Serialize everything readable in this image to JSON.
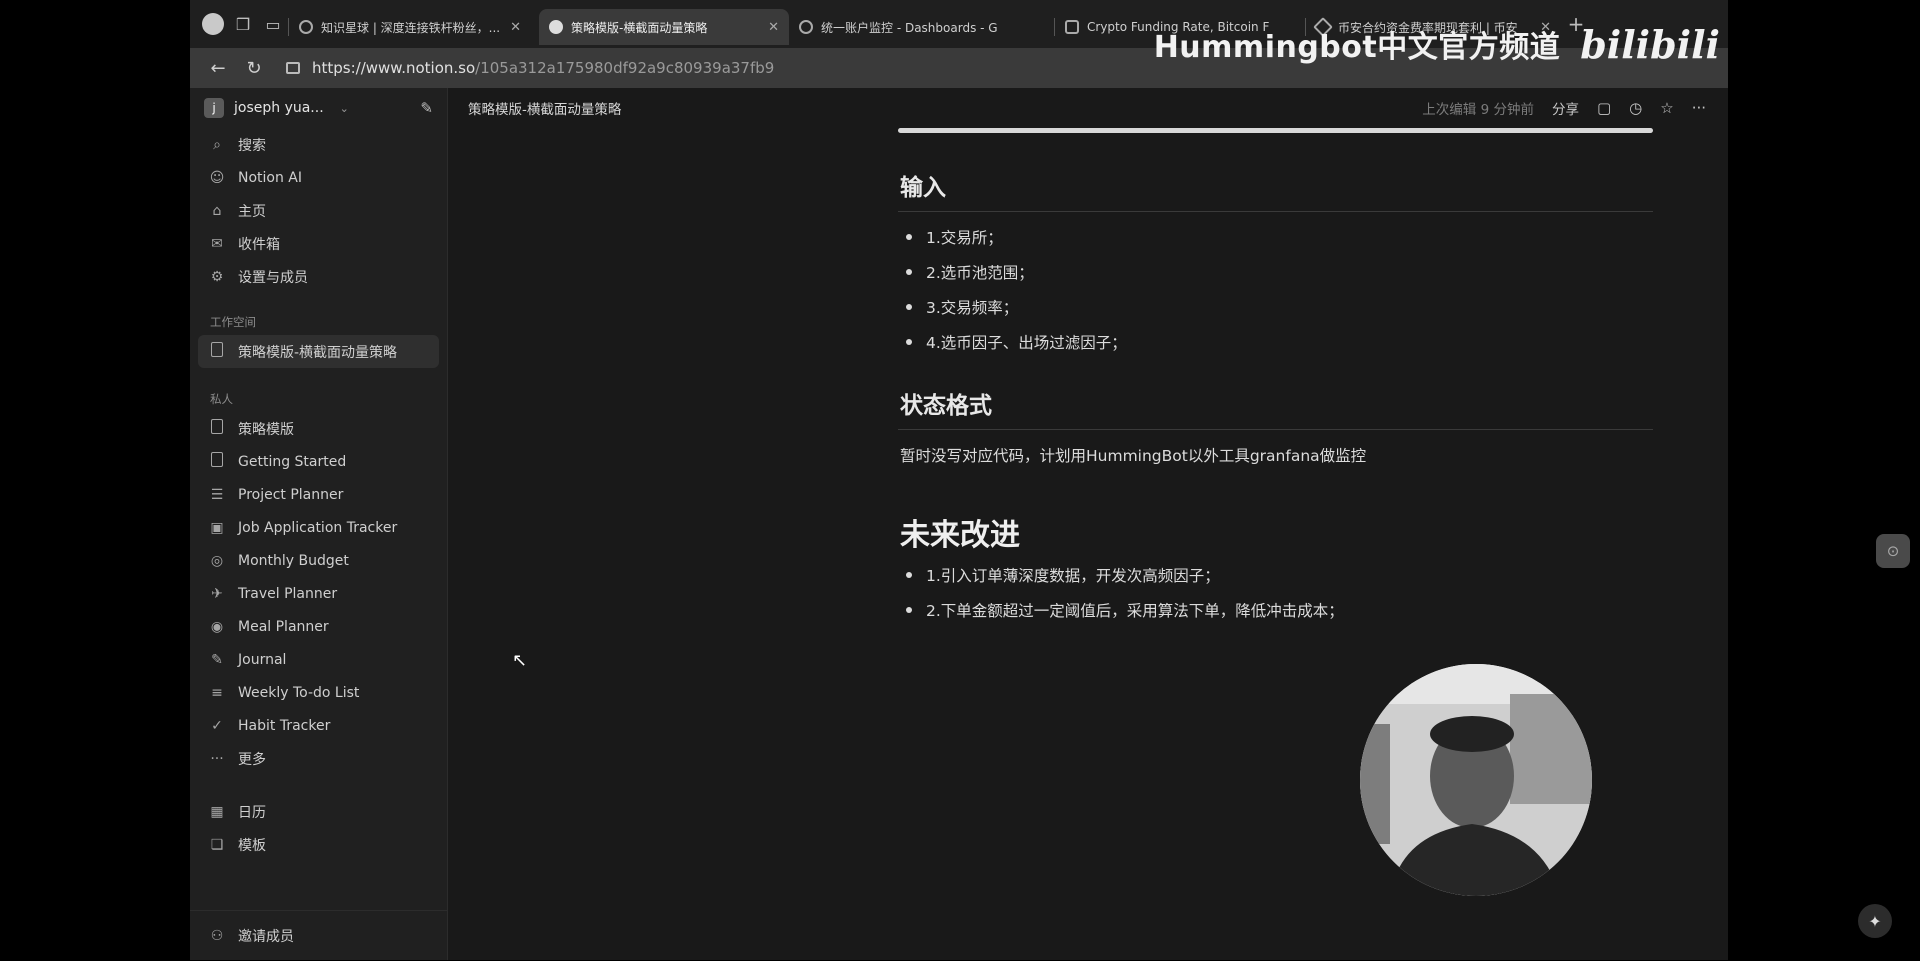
{
  "browser": {
    "tabs": [
      {
        "label": "知识星球 | 深度连接铁杆粉丝，..."
      },
      {
        "label": "策略模版-横截面动量策略"
      },
      {
        "label": "统一账户监控 - Dashboards - G"
      },
      {
        "label": "Crypto Funding Rate, Bitcoin F"
      },
      {
        "label": "币安合约资金费率期现套利 | 币安"
      }
    ],
    "url_host": "https://www.notion.so",
    "url_path": "/105a312a175980df92a9c80939a37fb9"
  },
  "watermark": {
    "text": "Hummingbot中文官方频道",
    "logo": "bilibili"
  },
  "sidebar": {
    "workspace_initial": "j",
    "workspace_name": "joseph yua...",
    "top_items": [
      {
        "label": "搜索",
        "icon": "search-icon"
      },
      {
        "label": "Notion AI",
        "icon": "notion-ai-icon"
      },
      {
        "label": "主页",
        "icon": "home-icon"
      },
      {
        "label": "收件箱",
        "icon": "inbox-icon"
      },
      {
        "label": "设置与成员",
        "icon": "gear-icon"
      }
    ],
    "workspace_label": "工作空间",
    "workspace_page": "策略模版-横截面动量策略",
    "private_label": "私人",
    "private_items": [
      {
        "label": "策略模版",
        "icon": "page-icon"
      },
      {
        "label": "Getting Started",
        "icon": "page-icon"
      },
      {
        "label": "Project Planner",
        "icon": "checklist-icon"
      },
      {
        "label": "Job Application Tracker",
        "icon": "briefcase-icon"
      },
      {
        "label": "Monthly Budget",
        "icon": "coins-icon"
      },
      {
        "label": "Travel Planner",
        "icon": "airplane-icon"
      },
      {
        "label": "Meal Planner",
        "icon": "plate-icon"
      },
      {
        "label": "Journal",
        "icon": "pencil-icon"
      },
      {
        "label": "Weekly To-do List",
        "icon": "list-icon"
      },
      {
        "label": "Habit Tracker",
        "icon": "check-icon"
      },
      {
        "label": "更多",
        "icon": "more-icon"
      }
    ],
    "calendar": "日历",
    "templates": "模板",
    "invite": "邀请成员"
  },
  "topbar": {
    "breadcrumb": "策略模版-横截面动量策略",
    "edited": "上次编辑 9 分钟前",
    "share": "分享"
  },
  "page": {
    "input_heading": "输入",
    "input_items": [
      "1.交易所；",
      "2.选币池范围；",
      "3.交易频率；",
      "4.选币因子、出场过滤因子；"
    ],
    "status_heading": "状态格式",
    "status_text": "暂时没写对应代码，计划用HummingBot以外工具granfana做监控",
    "future_heading": "未来改进",
    "future_items": [
      "1.引入订单薄深度数据，开发次高频因子；",
      "2.下单金额超过一定阈值后，采用算法下单，降低冲击成本；"
    ]
  }
}
